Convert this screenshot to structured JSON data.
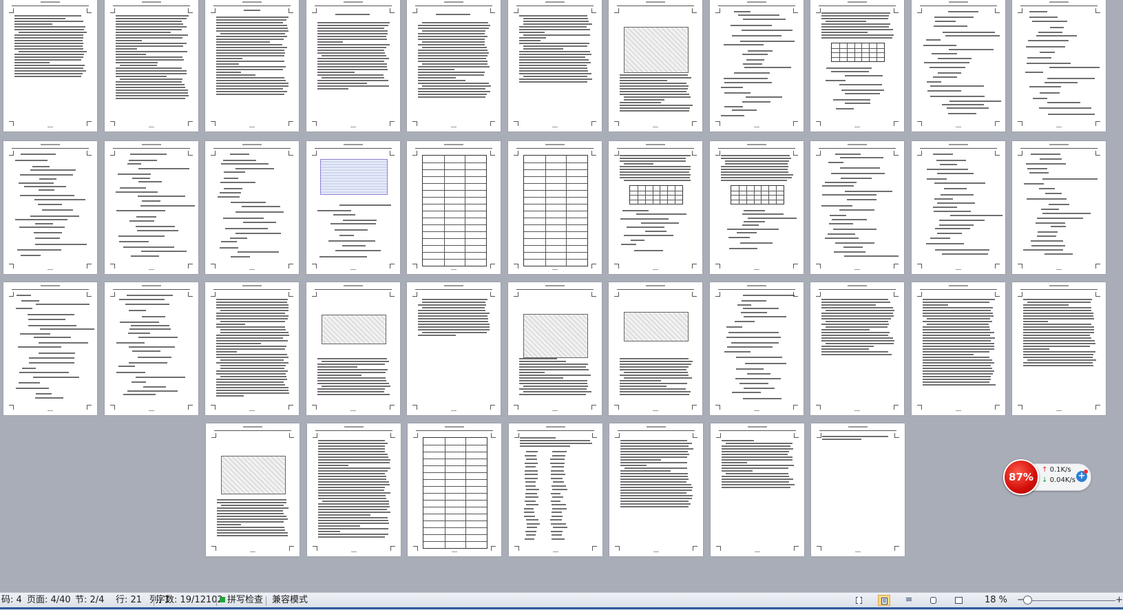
{
  "document": {
    "total_pages": 40,
    "rows": [
      {
        "pages": [
          {
            "type": "text"
          },
          {
            "type": "text"
          },
          {
            "type": "toc"
          },
          {
            "type": "chapter"
          },
          {
            "type": "chapter"
          },
          {
            "type": "text"
          },
          {
            "type": "figure"
          },
          {
            "type": "formula"
          },
          {
            "type": "table"
          },
          {
            "type": "formula"
          },
          {
            "type": "formula"
          }
        ]
      },
      {
        "pages": [
          {
            "type": "formula"
          },
          {
            "type": "formula"
          },
          {
            "type": "formula"
          },
          {
            "type": "cad"
          },
          {
            "type": "bigtable"
          },
          {
            "type": "bigtable"
          },
          {
            "type": "table"
          },
          {
            "type": "table"
          },
          {
            "type": "formula"
          },
          {
            "type": "formula"
          },
          {
            "type": "formula"
          }
        ]
      },
      {
        "pages": [
          {
            "type": "formula"
          },
          {
            "type": "formula"
          },
          {
            "type": "text"
          },
          {
            "type": "figure"
          },
          {
            "type": "text"
          },
          {
            "type": "figure"
          },
          {
            "type": "figure"
          },
          {
            "type": "formula"
          },
          {
            "type": "text"
          },
          {
            "type": "text"
          },
          {
            "type": "text"
          }
        ]
      },
      {
        "pages": [
          {
            "type": "figure"
          },
          {
            "type": "text"
          },
          {
            "type": "bigtable"
          },
          {
            "type": "list"
          },
          {
            "type": "text"
          },
          {
            "type": "text"
          },
          {
            "type": "blank"
          }
        ]
      }
    ]
  },
  "statusbar": {
    "page_code": "码: 4",
    "page": "页面: 4/40",
    "section": "节: 2/4",
    "line": "行: 21",
    "column": "列: 1",
    "word_count": "字数: 19/12102",
    "spell_check": "拼写检查",
    "compat_mode": "兼容模式",
    "zoom": "18 %",
    "zoom_minus": "−",
    "zoom_plus": "+",
    "view_icons": [
      "fullscreen-reading-icon",
      "page-view-icon",
      "outline-view-icon",
      "web-view-icon",
      "reading-layout-icon"
    ]
  },
  "network_widget": {
    "percent": "87%",
    "upload": "0.1K/s",
    "download": "0.04K/s",
    "accent": "#d20f0a"
  }
}
